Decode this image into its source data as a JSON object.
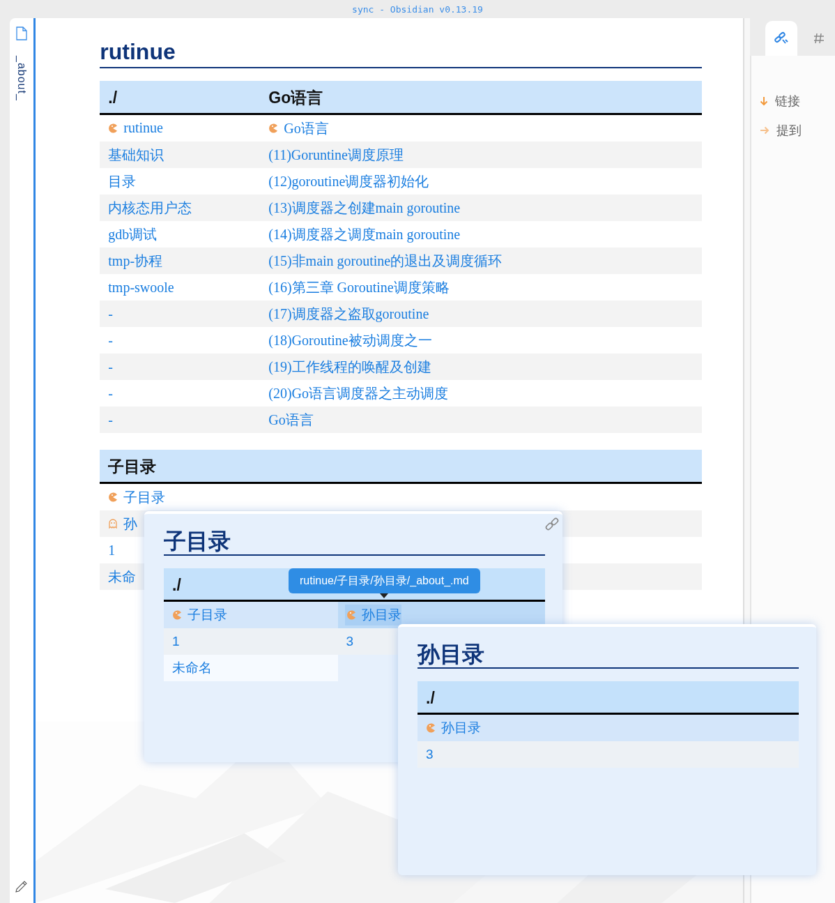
{
  "window": {
    "title": "sync - Obsidian v0.13.19"
  },
  "ribbon": {
    "tab_label": "_about_"
  },
  "note": {
    "title": "rutinue",
    "tables": [
      {
        "columns": [
          "./",
          "Go语言"
        ],
        "rows": [
          [
            {
              "text": "rutinue",
              "kind": "file"
            },
            {
              "text": "Go语言",
              "kind": "file"
            }
          ],
          [
            {
              "text": "基础知识"
            },
            {
              "text": "(11)Goruntine调度原理"
            }
          ],
          [
            {
              "text": "目录"
            },
            {
              "text": "(12)goroutine调度器初始化"
            }
          ],
          [
            {
              "text": "内核态用户态"
            },
            {
              "text": "(13)调度器之创建main goroutine"
            }
          ],
          [
            {
              "text": "gdb调试"
            },
            {
              "text": "(14)调度器之调度main goroutine"
            }
          ],
          [
            {
              "text": "tmp-协程"
            },
            {
              "text": "(15)非main goroutine的退出及调度循环"
            }
          ],
          [
            {
              "text": "tmp-swoole"
            },
            {
              "text": "(16)第三章 Goroutine调度策略"
            }
          ],
          [
            {
              "text": "-"
            },
            {
              "text": "(17)调度器之盗取goroutine"
            }
          ],
          [
            {
              "text": "-"
            },
            {
              "text": "(18)Goroutine被动调度之一"
            }
          ],
          [
            {
              "text": "-"
            },
            {
              "text": "(19)工作线程的唤醒及创建"
            }
          ],
          [
            {
              "text": "-"
            },
            {
              "text": "(20)Go语言调度器之主动调度"
            }
          ],
          [
            {
              "text": "-"
            },
            {
              "text": "Go语言"
            }
          ]
        ]
      },
      {
        "columns": [
          "子目录"
        ],
        "rows": [
          [
            {
              "text": "子目录",
              "kind": "file"
            }
          ],
          [
            {
              "text": "孙",
              "kind": "unresolved"
            }
          ],
          [
            {
              "text": "1"
            }
          ],
          [
            {
              "text": "未命"
            }
          ]
        ]
      }
    ]
  },
  "popovers": [
    {
      "title": "子目录",
      "columns": [
        "./"
      ],
      "tooltip": "rutinue/子目录/孙目录/_about_.md",
      "rows": [
        [
          {
            "text": "子目录",
            "kind": "file",
            "highlighted": false
          },
          {
            "text": "孙目录",
            "kind": "file",
            "highlighted": true
          }
        ],
        [
          {
            "text": "1",
            "highlighted": false
          },
          {
            "text": "3",
            "highlighted": false
          }
        ],
        [
          {
            "text": "未命名",
            "highlighted": false
          }
        ]
      ]
    },
    {
      "title": "孙目录",
      "columns": [
        "./"
      ],
      "rows": [
        [
          {
            "text": "孙目录",
            "kind": "file",
            "highlighted": false
          }
        ],
        [
          {
            "text": "3",
            "highlighted": false
          }
        ]
      ]
    }
  ],
  "right_pane": {
    "tabs": [
      {
        "kind": "links",
        "selected": true
      },
      {
        "kind": "tags",
        "selected": false
      }
    ],
    "items": [
      {
        "kind": "outgoing",
        "label": "链接"
      },
      {
        "kind": "mention",
        "label": "提到"
      }
    ]
  }
}
